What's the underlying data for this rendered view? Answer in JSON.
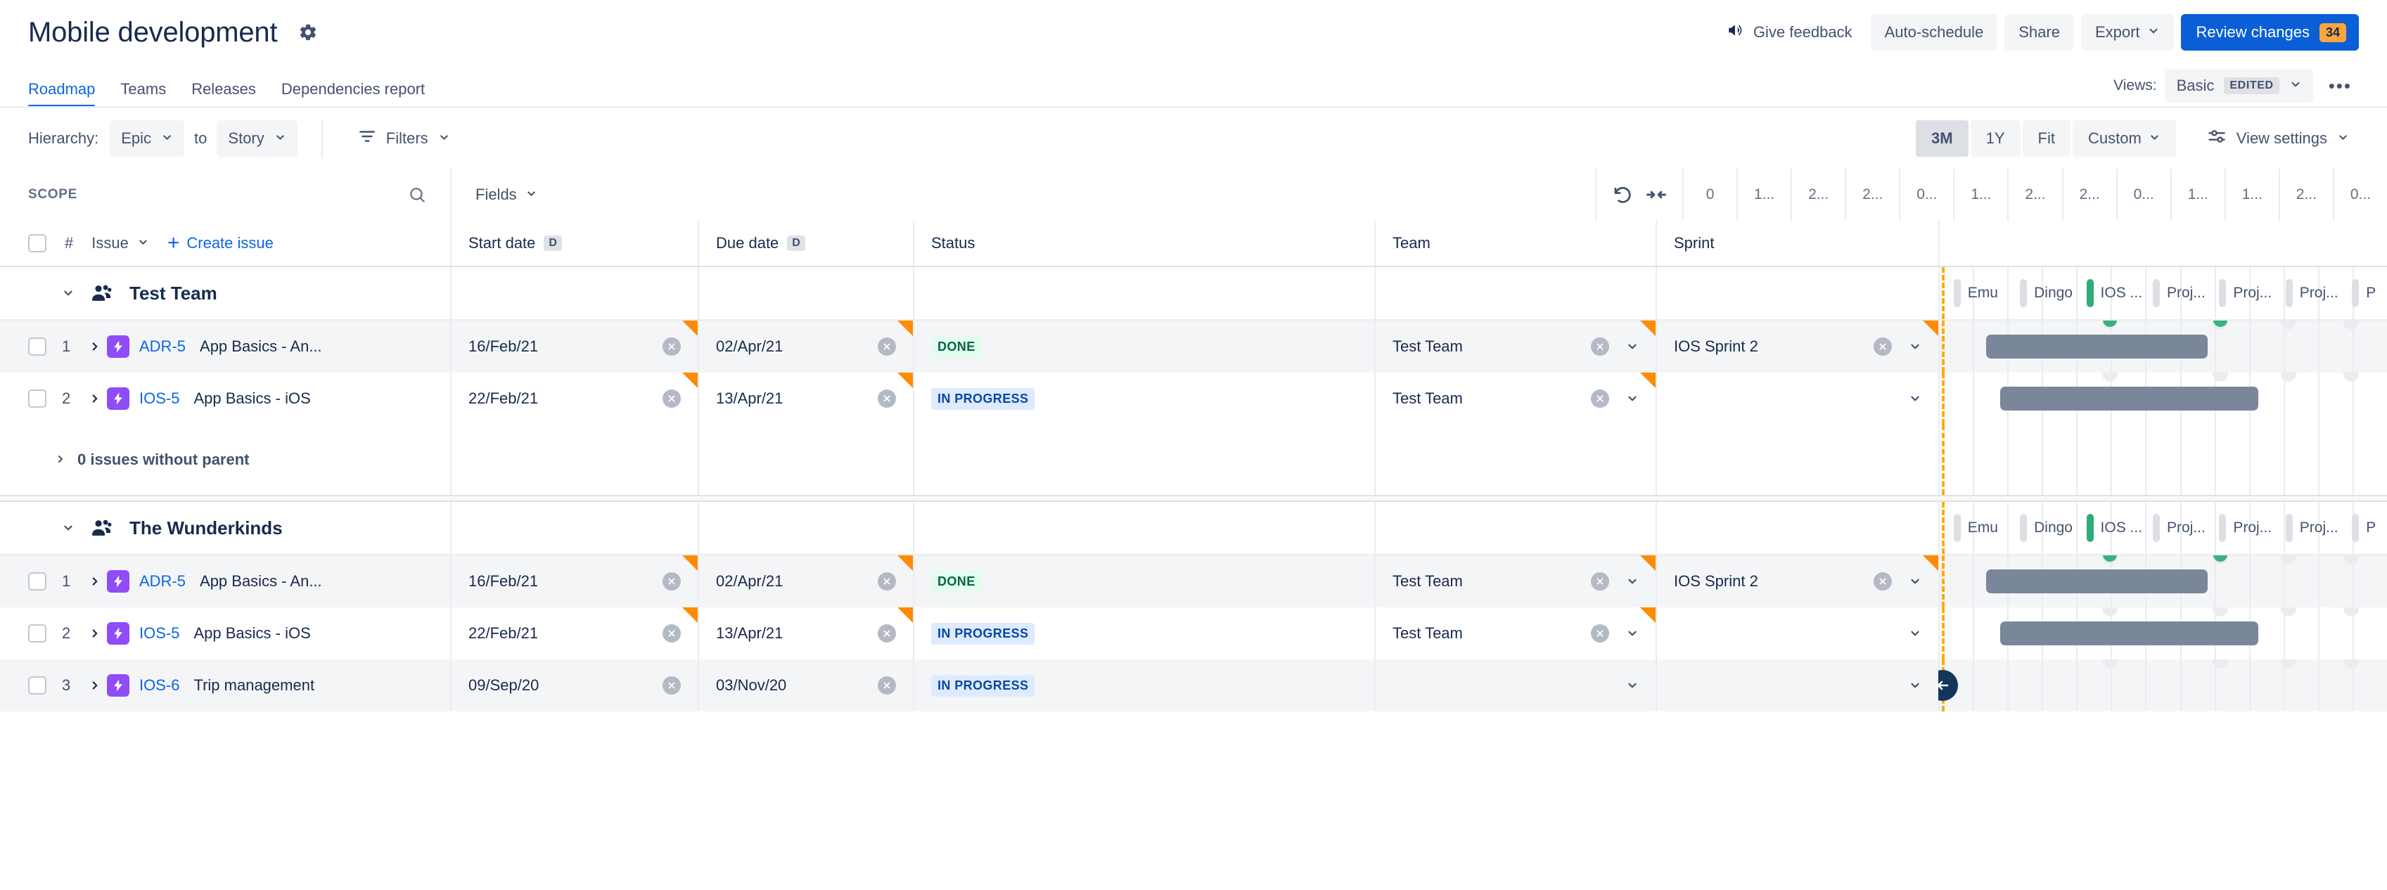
{
  "header": {
    "title": "Mobile development",
    "gear_icon": "gear-icon",
    "give_feedback": "Give feedback",
    "auto_schedule": "Auto-schedule",
    "share": "Share",
    "export": "Export",
    "review_changes": "Review changes",
    "review_changes_count": "34"
  },
  "tabs": [
    {
      "label": "Roadmap",
      "active": true
    },
    {
      "label": "Teams",
      "active": false
    },
    {
      "label": "Releases",
      "active": false
    },
    {
      "label": "Dependencies report",
      "active": false
    }
  ],
  "views": {
    "label": "Views:",
    "current": "Basic",
    "state_chip": "EDITED",
    "more": "•••"
  },
  "controls": {
    "hierarchy_label": "Hierarchy:",
    "hierarchy_from": "Epic",
    "to": "to",
    "hierarchy_to": "Story",
    "filters": "Filters",
    "zoom_levels": [
      "3M",
      "1Y",
      "Fit",
      "Custom"
    ],
    "zoom_active": "3M",
    "view_settings": "View settings"
  },
  "scope": {
    "title": "SCOPE",
    "search_icon": "search-icon",
    "fields_label": "Fields",
    "hash": "#",
    "issue_col": "Issue",
    "create_issue": "Create issue"
  },
  "columns": {
    "start_date": "Start date",
    "start_date_chip": "D",
    "due_date": "Due date",
    "due_date_chip": "D",
    "status": "Status",
    "team": "Team",
    "sprint": "Sprint"
  },
  "timeline": {
    "undo_icon": "undo-icon",
    "collapse_icon": "collapse-icon",
    "tick_labels": [
      "0",
      "1...",
      "2...",
      "2...",
      "0...",
      "1...",
      "2...",
      "2...",
      "0...",
      "1...",
      "1...",
      "2...",
      "0..."
    ],
    "sprint_lane_labels": [
      "Emu",
      "Dingo",
      "IOS ...",
      "Proj...",
      "Proj...",
      "Proj...",
      "P"
    ],
    "scroll_to_icon": "arrow-left-icon"
  },
  "groups": [
    {
      "name": "Test Team",
      "icon": "people-icon",
      "expanded": true,
      "rows": [
        {
          "num": "1",
          "type_icon": "epic-icon",
          "key": "ADR-5",
          "summary": "App Basics - An...",
          "start_date": "16/Feb/21",
          "due_date": "02/Apr/21",
          "status": "DONE",
          "status_kind": "done",
          "team": "Test Team",
          "sprint": "IOS Sprint 2",
          "highlighted": true,
          "changed": {
            "start": true,
            "due": true,
            "team": true,
            "sprint": true
          },
          "bar": {
            "left": 10.6,
            "width": 49.5
          }
        },
        {
          "num": "2",
          "type_icon": "epic-icon",
          "key": "IOS-5",
          "summary": "App Basics - iOS",
          "start_date": "22/Feb/21",
          "due_date": "13/Apr/21",
          "status": "IN PROGRESS",
          "status_kind": "inprogress",
          "team": "Test Team",
          "sprint": "",
          "highlighted": false,
          "changed": {
            "start": true,
            "due": true,
            "team": true,
            "sprint": false
          },
          "bar": {
            "left": 13.8,
            "width": 57.5
          }
        }
      ],
      "footer": "0 issues without parent"
    },
    {
      "name": "The Wunderkinds",
      "icon": "people-icon",
      "expanded": true,
      "rows": [
        {
          "num": "1",
          "type_icon": "epic-icon",
          "key": "ADR-5",
          "summary": "App Basics - An...",
          "start_date": "16/Feb/21",
          "due_date": "02/Apr/21",
          "status": "DONE",
          "status_kind": "done",
          "team": "Test Team",
          "sprint": "IOS Sprint 2",
          "highlighted": true,
          "changed": {
            "start": true,
            "due": true,
            "team": true,
            "sprint": true
          },
          "bar": {
            "left": 10.6,
            "width": 49.5
          }
        },
        {
          "num": "2",
          "type_icon": "epic-icon",
          "key": "IOS-5",
          "summary": "App Basics - iOS",
          "start_date": "22/Feb/21",
          "due_date": "13/Apr/21",
          "status": "IN PROGRESS",
          "status_kind": "inprogress",
          "team": "Test Team",
          "sprint": "",
          "highlighted": false,
          "changed": {
            "start": true,
            "due": true,
            "team": true,
            "sprint": false
          },
          "bar": {
            "left": 13.8,
            "width": 57.5
          }
        },
        {
          "num": "3",
          "type_icon": "epic-icon",
          "key": "IOS-6",
          "summary": "Trip management",
          "start_date": "09/Sep/20",
          "due_date": "03/Nov/20",
          "status": "IN PROGRESS",
          "status_kind": "inprogress",
          "team": "",
          "sprint": "",
          "highlighted": true,
          "changed": {
            "start": false,
            "due": false,
            "team": false,
            "sprint": false
          },
          "bar": null
        }
      ],
      "footer": ""
    }
  ],
  "colors": {
    "accent_blue": "#0C66E4",
    "primary_button": "#0B5FD6",
    "badge_orange": "#FAA53D",
    "epic_purple": "#8F4CF7",
    "done_green": "#006644",
    "inprogress_blue": "#0747A6",
    "bar_grey": "#7A869A",
    "release_green": "#36B37E",
    "today_line": "#FFAB00"
  }
}
